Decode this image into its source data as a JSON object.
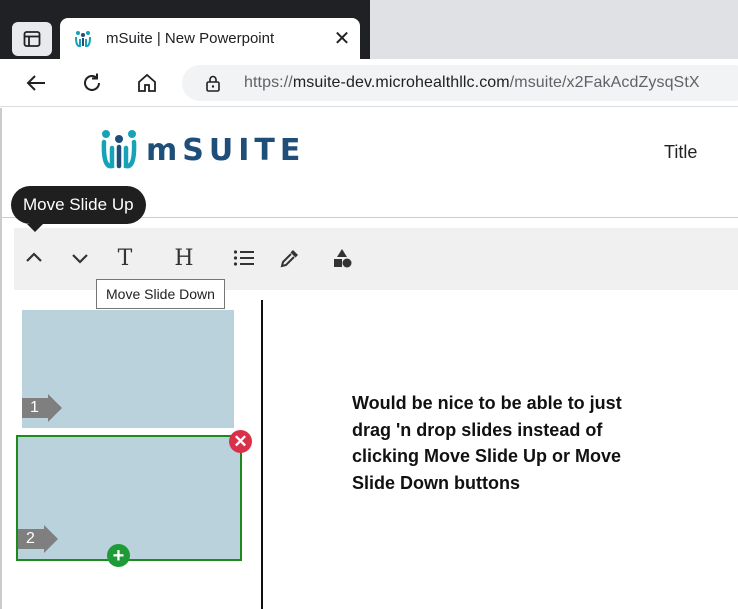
{
  "browser": {
    "tab_title": "mSuite | New Powerpoint",
    "url_prefix": "https://",
    "url_host": "msuite-dev.microhealthllc.com",
    "url_path": "/msuite/x2FakAcdZysqStX"
  },
  "app": {
    "logo_text": "mSUITE",
    "nav_title": "Title"
  },
  "toolbar": {
    "text_label": "T",
    "heading_label": "H"
  },
  "tooltips": {
    "move_up": "Move Slide Up",
    "move_down": "Move Slide Down"
  },
  "slides": [
    {
      "number": "1"
    },
    {
      "number": "2"
    }
  ],
  "note": "Would be nice to be able to just drag 'n drop slides instead of clicking Move Slide Up or Move Slide Down buttons",
  "colors": {
    "brand_teal": "#17a2b8",
    "brand_navy": "#1f4e79",
    "slide_bg": "#b9d2dc",
    "selected_border": "#1e8a1e",
    "delete_red": "#d9314a",
    "add_green": "#1e9a36"
  }
}
